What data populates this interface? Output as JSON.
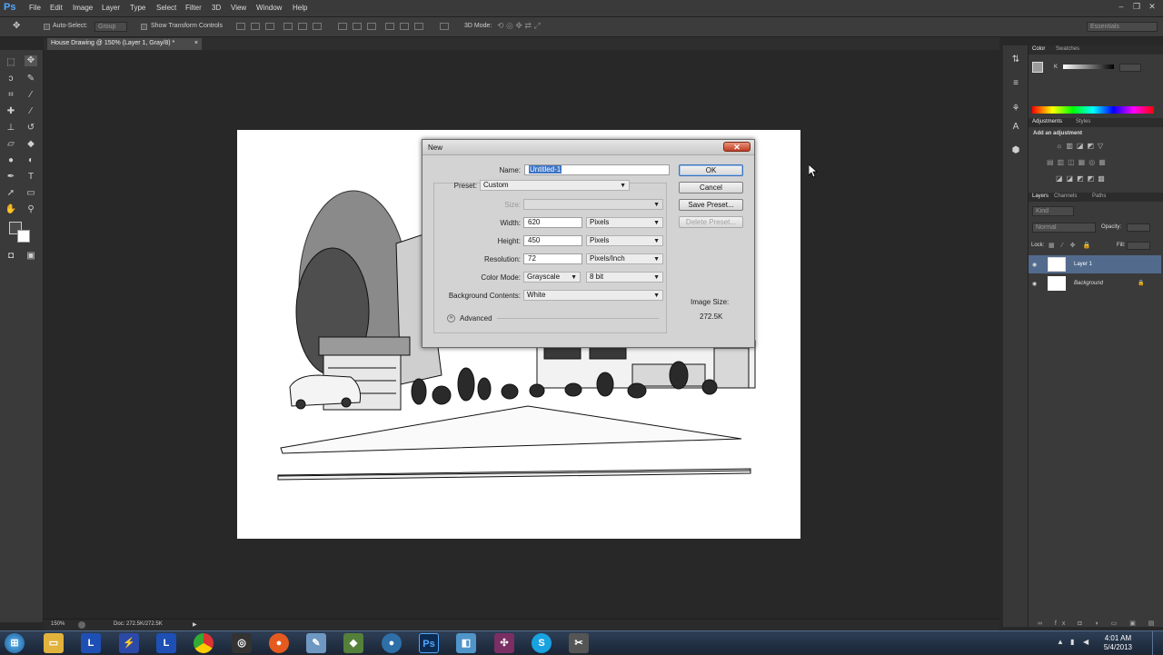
{
  "app": {
    "logo": "Ps"
  },
  "menu": [
    "File",
    "Edit",
    "Image",
    "Layer",
    "Type",
    "Select",
    "Filter",
    "3D",
    "View",
    "Window",
    "Help"
  ],
  "options_bar": {
    "auto_select_label": "Auto-Select:",
    "auto_select_value": "Group",
    "show_transform_label": "Show Transform Controls",
    "mode_3d_label": "3D Mode:",
    "workspace": "Essentials"
  },
  "document_tab": {
    "title": "House Drawing @ 150% (Layer 1, Gray/8) *"
  },
  "status_bar": {
    "zoom": "150%",
    "doc_info": "Doc: 272.5K/272.5K"
  },
  "dialog": {
    "title": "New",
    "name_label": "Name:",
    "name_value": "Untitled-1",
    "preset_label": "Preset:",
    "preset_value": "Custom",
    "size_label": "Size:",
    "width_label": "Width:",
    "width_value": "620",
    "width_unit": "Pixels",
    "height_label": "Height:",
    "height_value": "450",
    "height_unit": "Pixels",
    "resolution_label": "Resolution:",
    "resolution_value": "72",
    "resolution_unit": "Pixels/Inch",
    "color_mode_label": "Color Mode:",
    "color_mode_value": "Grayscale",
    "bit_depth": "8 bit",
    "bg_contents_label": "Background Contents:",
    "bg_contents_value": "White",
    "advanced_label": "Advanced",
    "ok_label": "OK",
    "cancel_label": "Cancel",
    "save_preset_label": "Save Preset...",
    "delete_preset_label": "Delete Preset...",
    "image_size_label": "Image Size:",
    "image_size_value": "272.5K"
  },
  "panels": {
    "color_tabs": [
      "Color",
      "Swatches"
    ],
    "color_channel": "K",
    "adjustment_tabs": [
      "Adjustments",
      "Styles"
    ],
    "add_adjustment": "Add an adjustment",
    "layers_tabs": [
      "Layers",
      "Channels",
      "Paths"
    ],
    "kind_label": "Kind",
    "blend_mode": "Normal",
    "opacity_label": "Opacity:",
    "lock_label": "Lock:",
    "fill_label": "Fill:",
    "layers": [
      {
        "name": "Layer 1"
      },
      {
        "name": "Background"
      }
    ]
  },
  "taskbar": {
    "clock_time": "4:01 AM",
    "clock_date": "5/4/2013"
  },
  "colors": {
    "accent": "#3a70b8",
    "panel": "#3a3a3a",
    "canvas_bg": "#282828",
    "selection": "#3d74c4"
  }
}
